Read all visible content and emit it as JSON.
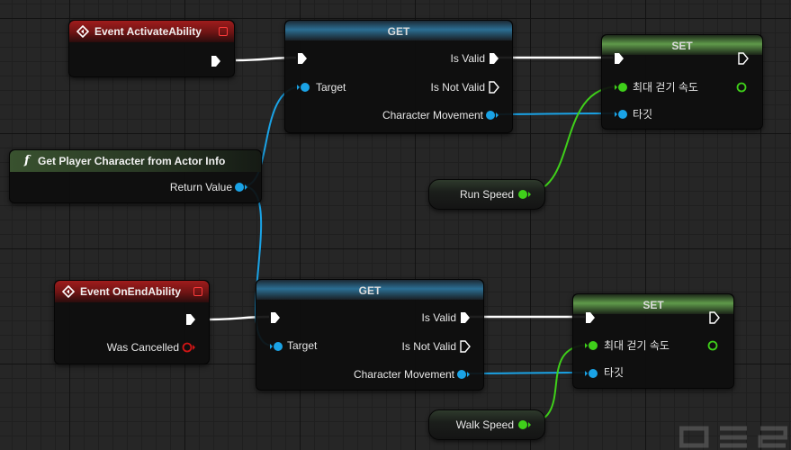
{
  "colors": {
    "exec": "#ffffff",
    "object": "#1aa3e6",
    "float": "#3fcf1a",
    "bool": "#d01515"
  },
  "nodes": {
    "event_activate": {
      "title": "Event ActivateAbility"
    },
    "event_end": {
      "title": "Event OnEndAbility",
      "was_cancelled": "Was Cancelled"
    },
    "func_get_player": {
      "title": "Get Player Character from Actor Info",
      "return_value": "Return Value"
    },
    "get_top": {
      "title": "GET",
      "target": "Target",
      "is_valid": "Is Valid",
      "is_not_valid": "Is Not Valid",
      "char_movement": "Character Movement"
    },
    "get_bottom": {
      "title": "GET",
      "target": "Target",
      "is_valid": "Is Valid",
      "is_not_valid": "Is Not Valid",
      "char_movement": "Character Movement"
    },
    "set_top": {
      "title": "SET",
      "max_walk_speed": "최대 걷기 속도",
      "target": "타깃"
    },
    "set_bottom": {
      "title": "SET",
      "max_walk_speed": "최대 걷기 속도",
      "target": "타깃"
    },
    "var_run": {
      "label": "Run Speed"
    },
    "var_walk": {
      "label": "Walk Speed"
    }
  }
}
